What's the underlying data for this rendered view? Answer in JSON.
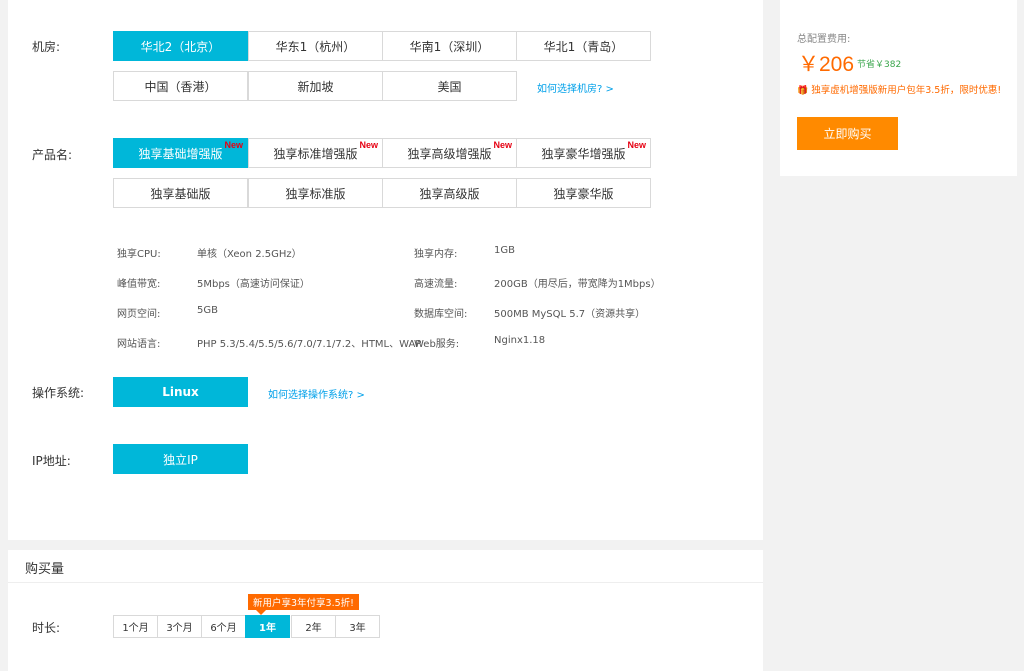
{
  "region": {
    "label": "机房:",
    "options": [
      "华北2（北京）",
      "华东1（杭州）",
      "华南1（深圳）",
      "华北1（青岛）",
      "中国（香港）",
      "新加坡",
      "美国"
    ],
    "selected": "华北2（北京）",
    "help_link": "如何选择机房? >"
  },
  "product": {
    "label": "产品名:",
    "options": [
      "独享基础增强版",
      "独享标准增强版",
      "独享高级增强版",
      "独享豪华增强版",
      "独享基础版",
      "独享标准版",
      "独享高级版",
      "独享豪华版"
    ],
    "new_tag": "New",
    "selected": "独享基础增强版"
  },
  "specs": [
    {
      "key": "独享CPU:",
      "value": "单核（Xeon 2.5GHz）"
    },
    {
      "key": "独享内存:",
      "value": "1GB"
    },
    {
      "key": "峰值带宽:",
      "value": "5Mbps（高速访问保证）"
    },
    {
      "key": "高速流量:",
      "value": "200GB（用尽后，带宽降为1Mbps）"
    },
    {
      "key": "网页空间:",
      "value": "5GB"
    },
    {
      "key": "数据库空间:",
      "value": "500MB MySQL 5.7（资源共享）"
    },
    {
      "key": "网站语言:",
      "value": "PHP 5.3/5.4/5.5/5.6/7.0/7.1/7.2、HTML、WAP"
    },
    {
      "key": "Web服务:",
      "value": "Nginx1.18"
    }
  ],
  "os": {
    "label": "操作系统:",
    "option": "Linux",
    "help_link": "如何选择操作系统? >"
  },
  "ip": {
    "label": "IP地址:",
    "option": "独立IP"
  },
  "summary": {
    "label": "总配置费用:",
    "price": "￥206",
    "save": "节省￥382",
    "promo": "独享虚机增强版新用户包年3.5折，限时优惠!",
    "buy_button": "立即购买",
    "price_color": "#ff6a00",
    "button_color": "#ff8a00"
  },
  "purchase": {
    "title": "购买量",
    "duration_label": "时长:",
    "durations": [
      "1个月",
      "3个月",
      "6个月",
      "1年",
      "2年",
      "3年"
    ],
    "selected": "1年",
    "promo_flag": "新用户享3年付享3.5折!"
  },
  "accent_color": "#00b7d9"
}
